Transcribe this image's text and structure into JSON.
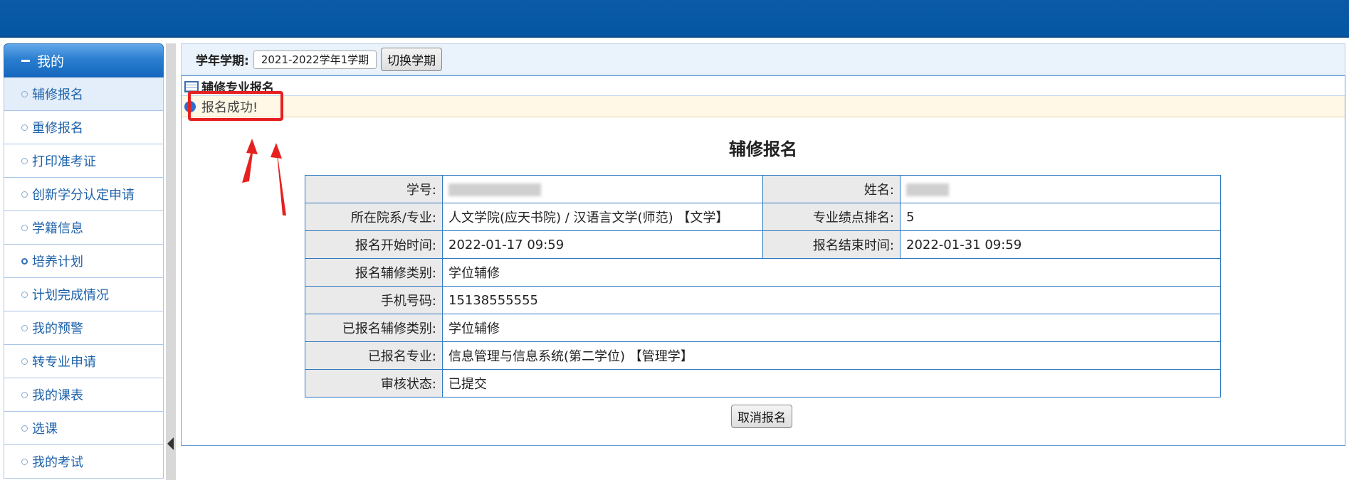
{
  "sidebar": {
    "header": "我的",
    "items": [
      {
        "label": "辅修报名"
      },
      {
        "label": "重修报名"
      },
      {
        "label": "打印准考证"
      },
      {
        "label": "创新学分认定申请"
      },
      {
        "label": "学籍信息"
      },
      {
        "label": "培养计划"
      },
      {
        "label": "计划完成情况"
      },
      {
        "label": "我的预警"
      },
      {
        "label": "转专业申请"
      },
      {
        "label": "我的课表"
      },
      {
        "label": "选课"
      },
      {
        "label": "我的考试"
      }
    ]
  },
  "term": {
    "label": "学年学期:",
    "value": "2021-2022学年1学期",
    "switch_label": "切换学期"
  },
  "panel": {
    "title": "辅修专业报名",
    "message": "报名成功!"
  },
  "form": {
    "title": "辅修报名",
    "rows": {
      "student_id_label": "学号:",
      "name_label": "姓名:",
      "dept_label": "所在院系/专业:",
      "dept_value": "人文学院(应天书院) / 汉语言文学(师范) 【文学】",
      "rank_label": "专业绩点排名:",
      "rank_value": "5",
      "start_label": "报名开始时间:",
      "start_value": "2022-01-17 09:59",
      "end_label": "报名结束时间:",
      "end_value": "2022-01-31 09:59",
      "type_label": "报名辅修类别:",
      "type_value": "学位辅修",
      "phone_label": "手机号码:",
      "phone_value": "15138555555",
      "registered_type_label": "已报名辅修类别:",
      "registered_type_value": "学位辅修",
      "registered_major_label": "已报名专业:",
      "registered_major_value": "信息管理与信息系统(第二学位) 【管理学】",
      "status_label": "审核状态:",
      "status_value": "已提交"
    },
    "cancel_label": "取消报名"
  },
  "colors": {
    "topbar": "#0456a2",
    "link": "#1e62aa",
    "table_border": "#2f79c2",
    "highlight": "#e62020"
  }
}
